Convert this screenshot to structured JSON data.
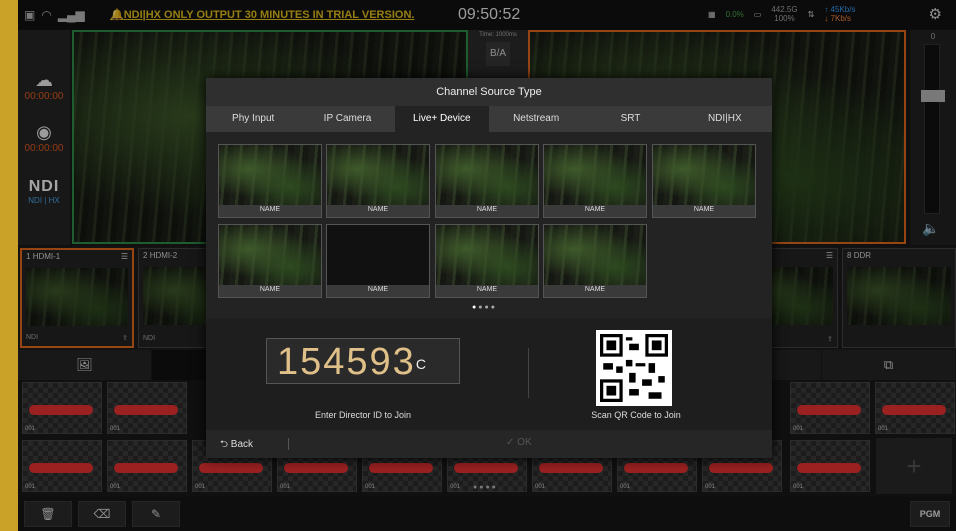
{
  "status": {
    "trial_msg": "NDI|HX ONLY OUTPUT 30 MINUTES IN TRIAL VERSION.",
    "clock": "09:50:52",
    "cpu": "0.0%",
    "battery_val": "442.5G",
    "battery_pct": "100%",
    "upload": "45Kb/s",
    "download": "7Kb/s"
  },
  "left": {
    "stream_time": "00:00:00",
    "record_time": "00:00:00",
    "ndi_logo": "NDI",
    "ndi_sub": "NDI | HX"
  },
  "transition": {
    "time": "Time: 1000ms",
    "label_b": "B",
    "label_a": "A"
  },
  "tbar": {
    "zero": "0"
  },
  "channels": [
    {
      "num": "1",
      "name": "HDMI-1",
      "sub": "NDI"
    },
    {
      "num": "2",
      "name": "HDMI-2",
      "sub": "NDI"
    },
    {
      "num": "8",
      "name": "DDR",
      "sub": ""
    }
  ],
  "assets": {
    "label": "001"
  },
  "bottom": {
    "pgm": "PGM"
  },
  "dialog": {
    "title": "Channel Source Type",
    "tabs": [
      "Phy Input",
      "IP Camera",
      "Live+ Device",
      "Netstream",
      "SRT",
      "NDI|HX"
    ],
    "device_name": "NAME",
    "code": "154593",
    "code_suffix": "C",
    "code_label": "Enter Director ID to Join",
    "qr_label": "Scan QR Code to Join",
    "back": "Back",
    "ok": "OK"
  }
}
